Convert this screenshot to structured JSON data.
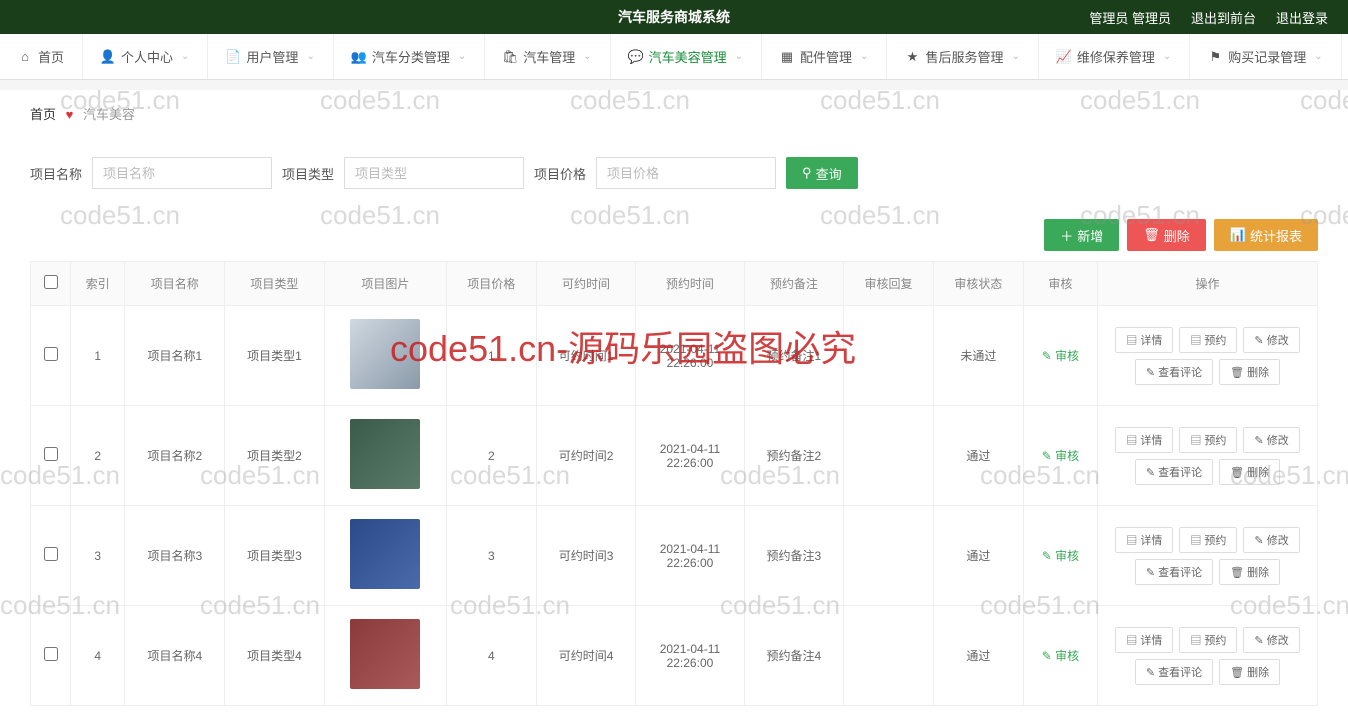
{
  "header": {
    "title": "汽车服务商城系统",
    "user_label": "管理员 管理员",
    "exit_front": "退出到前台",
    "logout": "退出登录"
  },
  "nav": [
    {
      "label": "首页",
      "icon": "home",
      "caret": false
    },
    {
      "label": "个人中心",
      "icon": "user",
      "caret": true
    },
    {
      "label": "用户管理",
      "icon": "doc",
      "caret": true
    },
    {
      "label": "汽车分类管理",
      "icon": "user2",
      "caret": true
    },
    {
      "label": "汽车管理",
      "icon": "bag",
      "caret": true
    },
    {
      "label": "汽车美容管理",
      "icon": "chat",
      "caret": true,
      "active": true
    },
    {
      "label": "配件管理",
      "icon": "grid",
      "caret": true
    },
    {
      "label": "售后服务管理",
      "icon": "star",
      "caret": true
    },
    {
      "label": "维修保养管理",
      "icon": "chart",
      "caret": true
    },
    {
      "label": "购买记录管理",
      "icon": "flag",
      "caret": true
    }
  ],
  "breadcrumb": {
    "home": "首页",
    "current": "汽车美容"
  },
  "search": {
    "name_label": "项目名称",
    "name_ph": "项目名称",
    "type_label": "项目类型",
    "type_ph": "项目类型",
    "price_label": "项目价格",
    "price_ph": "项目价格",
    "btn": "查询"
  },
  "actions": {
    "add": "新增",
    "del": "删除",
    "stat": "统计报表"
  },
  "columns": [
    "",
    "索引",
    "项目名称",
    "项目类型",
    "项目图片",
    "项目价格",
    "可约时间",
    "预约时间",
    "预约备注",
    "审核回复",
    "审核状态",
    "审核",
    "操作"
  ],
  "ops": {
    "detail": "详情",
    "book": "预约",
    "edit": "修改",
    "comments": "查看评论",
    "delete": "删除",
    "audit": "审核"
  },
  "rows": [
    {
      "idx": "1",
      "name": "项目名称1",
      "type": "项目类型1",
      "img": "c1",
      "price": "1",
      "avail": "可约时间1",
      "time": "2021-04-11 22:26:00",
      "remark": "预约备注1",
      "reply": "",
      "status": "未通过"
    },
    {
      "idx": "2",
      "name": "项目名称2",
      "type": "项目类型2",
      "img": "c2",
      "price": "2",
      "avail": "可约时间2",
      "time": "2021-04-11 22:26:00",
      "remark": "预约备注2",
      "reply": "",
      "status": "通过"
    },
    {
      "idx": "3",
      "name": "项目名称3",
      "type": "项目类型3",
      "img": "c3",
      "price": "3",
      "avail": "可约时间3",
      "time": "2021-04-11 22:26:00",
      "remark": "预约备注3",
      "reply": "",
      "status": "通过"
    },
    {
      "idx": "4",
      "name": "项目名称4",
      "type": "项目类型4",
      "img": "c4",
      "price": "4",
      "avail": "可约时间4",
      "time": "2021-04-11 22:26:00",
      "remark": "预约备注4",
      "reply": "",
      "status": "通过"
    }
  ],
  "watermarks": {
    "text": "code51.cn",
    "main": "code51.cn-源码乐园盗图必究"
  }
}
